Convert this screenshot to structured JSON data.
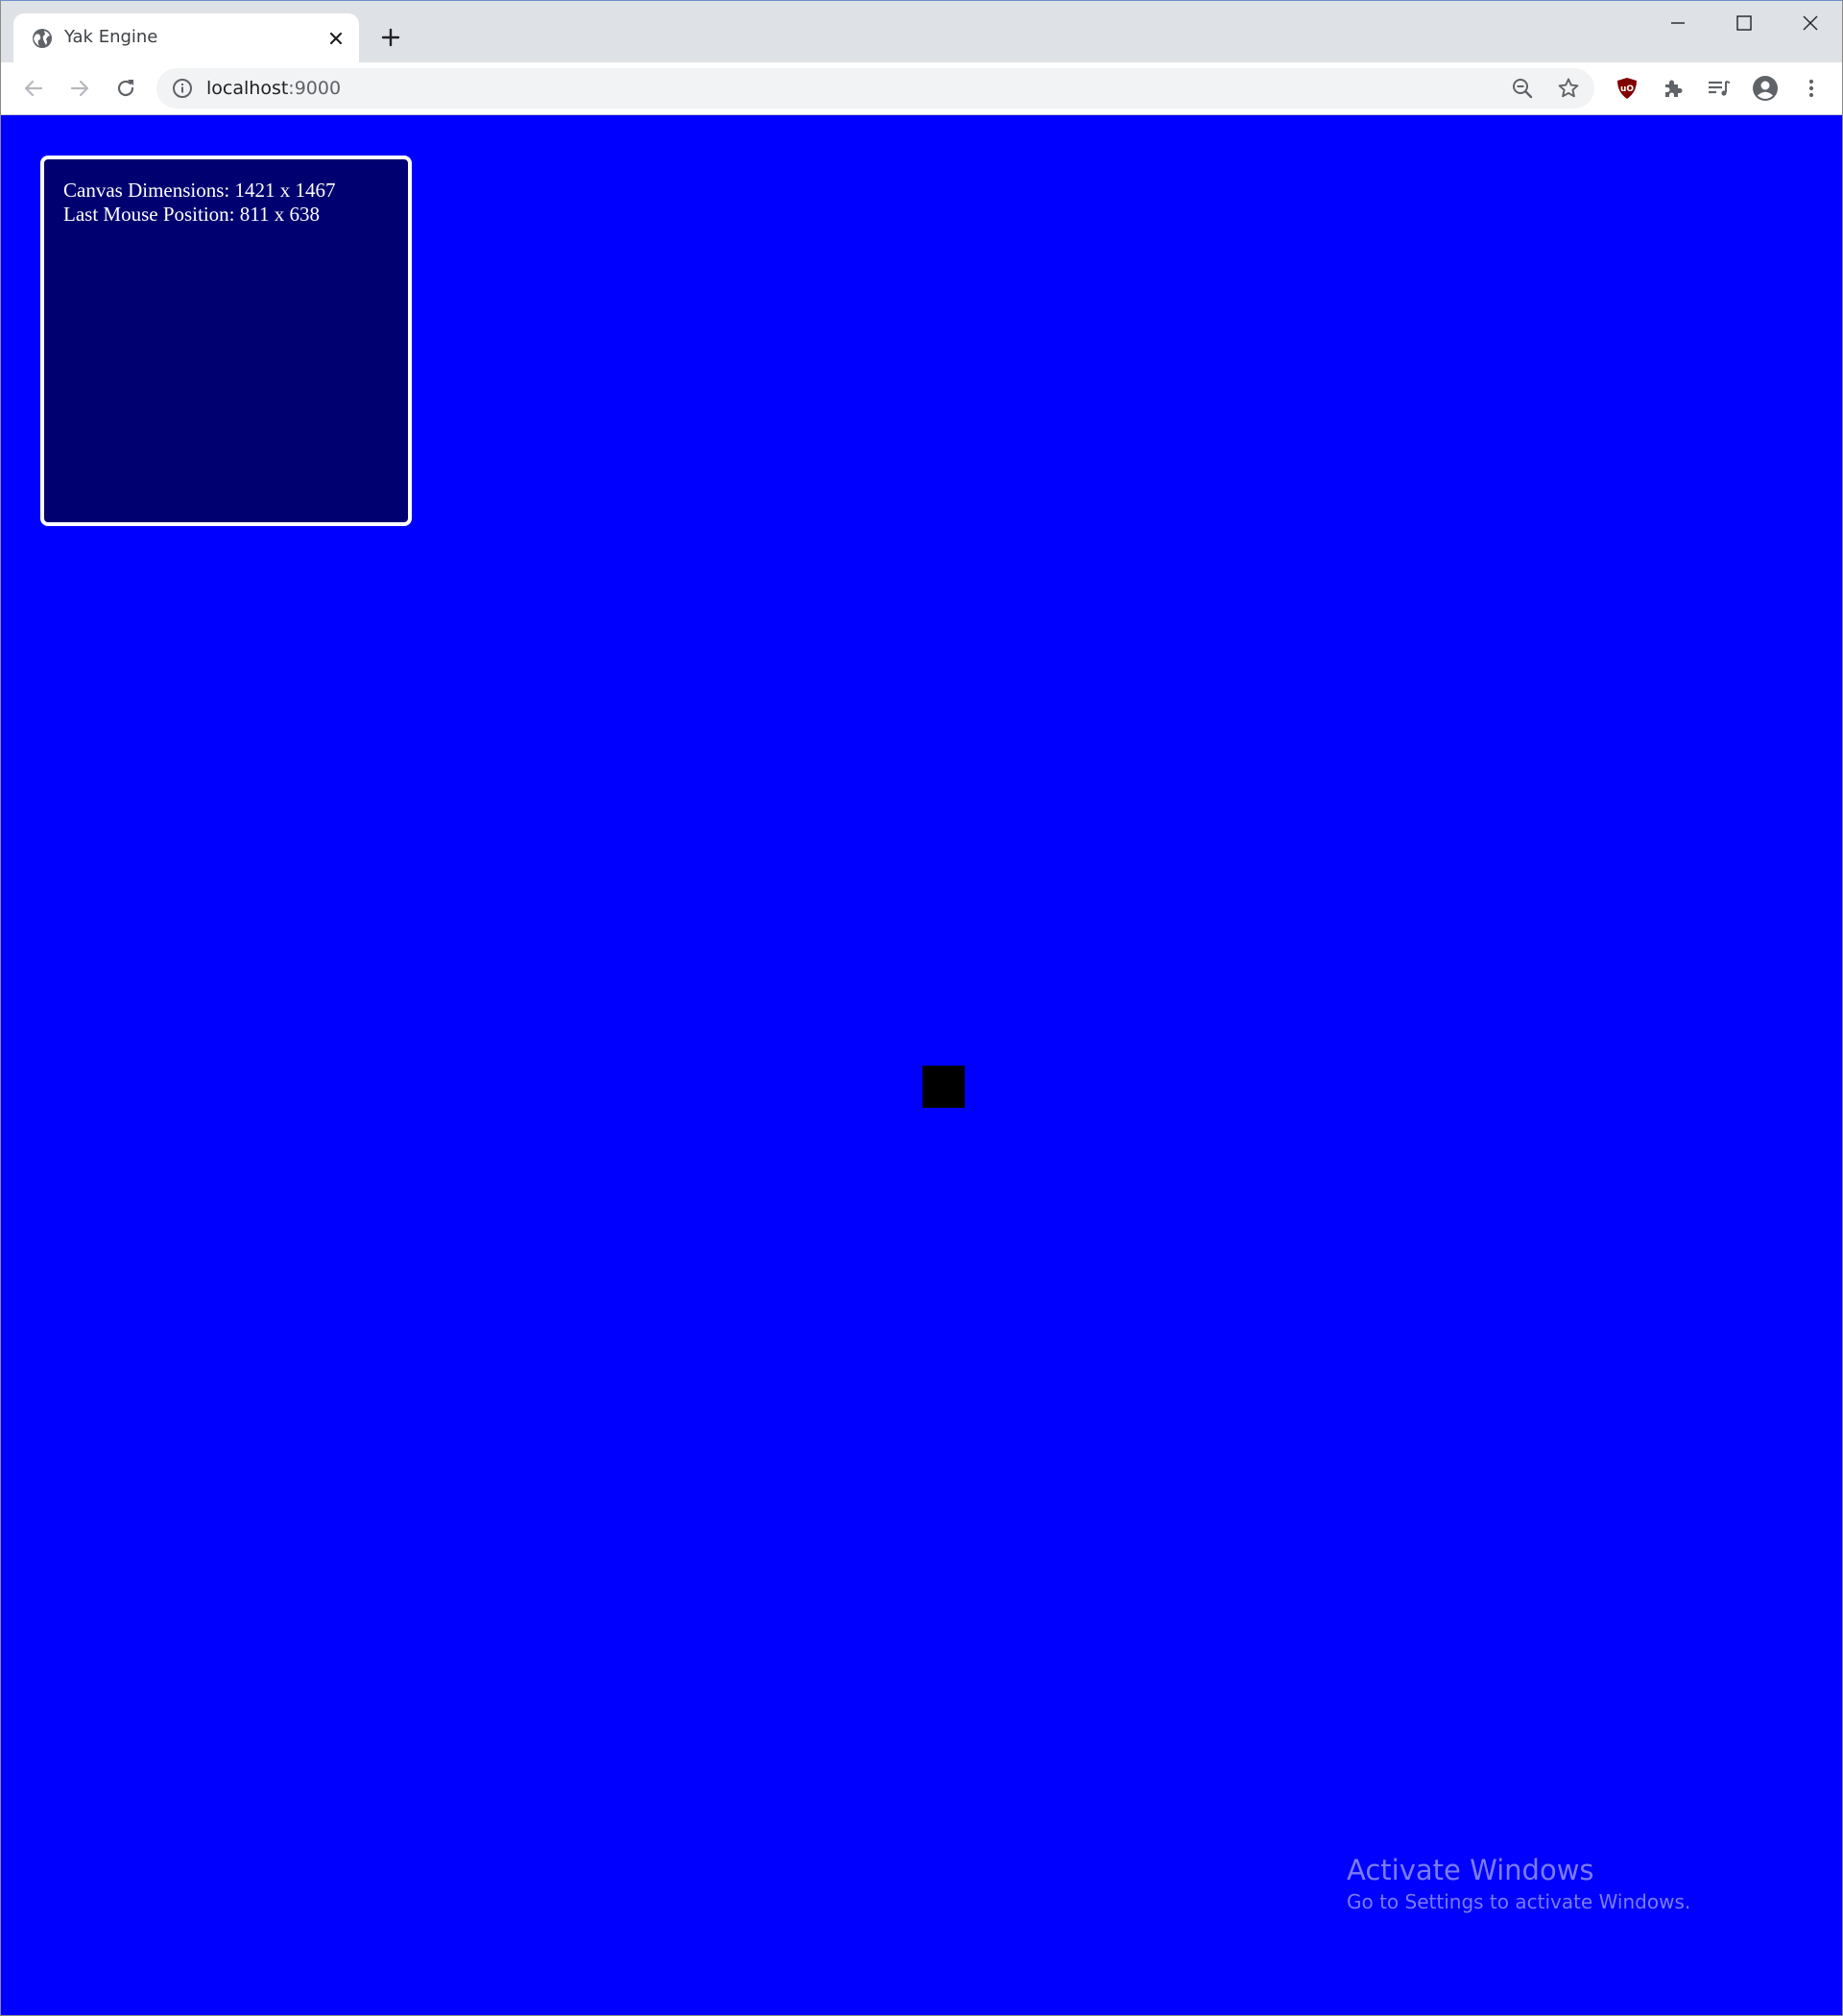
{
  "browser": {
    "tab": {
      "title": "Yak Engine"
    },
    "address_bar": {
      "host": "localhost",
      "port": ":9000"
    }
  },
  "icons": {
    "favicon": "globe-icon",
    "tab_close": "close-icon",
    "new_tab": "plus-icon",
    "minimize": "minimize-icon",
    "maximize": "maximize-icon",
    "close_window": "close-window-icon",
    "back": "back-arrow-icon",
    "forward": "forward-arrow-icon",
    "reload": "reload-icon",
    "site_info": "info-icon",
    "zoom": "zoom-out-icon",
    "bookmark": "star-icon",
    "extension_ublock": "ublock-origin-icon",
    "extensions": "puzzle-icon",
    "media": "media-queue-icon",
    "profile": "profile-icon",
    "menu": "kebab-menu-icon"
  },
  "page": {
    "info_panel": {
      "canvas_dimensions": "Canvas Dimensions: 1421 x 1467",
      "last_mouse_position": "Last Mouse Position: 811 x 638"
    },
    "watermark": {
      "title": "Activate Windows",
      "subtitle": "Go to Settings to activate Windows."
    }
  },
  "colors": {
    "canvas_background": "#0000ff",
    "panel_background": "#000070",
    "panel_border": "#ffffff",
    "sprite": "#000000",
    "tabstrip": "#dee1e6",
    "ublock_badge": "#800000"
  }
}
